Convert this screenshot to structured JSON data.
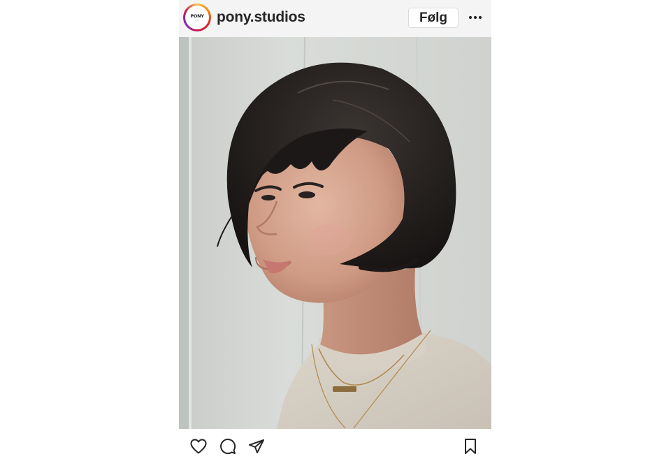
{
  "post": {
    "account": {
      "username": "pony.studios",
      "avatar_text": "PONY",
      "avatar_icon": "pony-studios-logo"
    },
    "follow_label": "Følg",
    "more_icon": "more-horizontal-icon",
    "photo": {
      "subject": "portrait-short-bob-haircut"
    },
    "actions": {
      "like_icon": "heart-icon",
      "comment_icon": "comment-icon",
      "share_icon": "send-icon",
      "save_icon": "bookmark-icon"
    }
  },
  "colors": {
    "header_bg": "#f4f4f4",
    "text": "#262626",
    "follow_border": "#dbdbdb"
  }
}
